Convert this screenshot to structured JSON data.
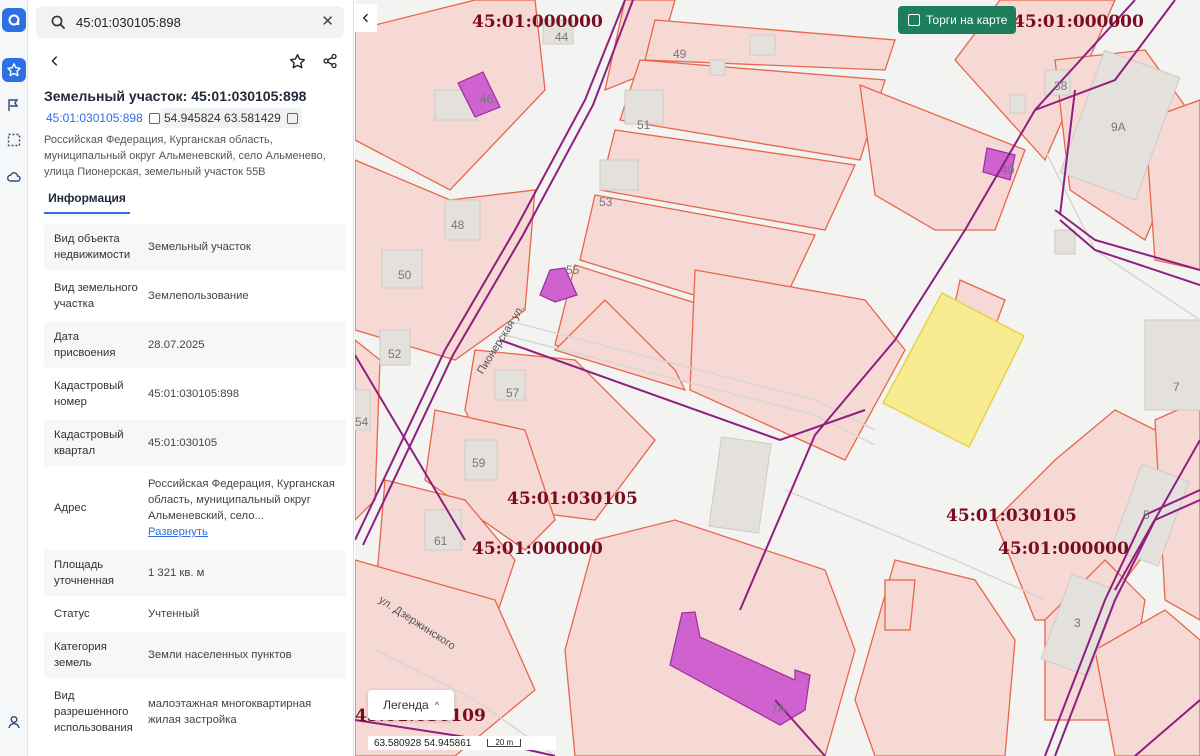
{
  "search": {
    "value": "45:01:030105:898"
  },
  "object": {
    "title": "Земельный участок: 45:01:030105:898",
    "cadastral_number": "45:01:030105:898",
    "coordinates": "54.945824 63.581429",
    "address": "Российская Федерация, Курганская область, муниципальный округ Альменевский, село Альменево, улица Пионерская, земельный участок 55В"
  },
  "tabs": [
    {
      "label": "Информация",
      "active": true
    }
  ],
  "info": [
    {
      "label": "Вид объекта недвижимости",
      "value": "Земельный участок"
    },
    {
      "label": "Вид земельного участка",
      "value": "Землепользование"
    },
    {
      "label": "Дата присвоения",
      "value": "28.07.2025"
    },
    {
      "label": "Кадастровый номер",
      "value": "45:01:030105:898"
    },
    {
      "label": "Кадастровый квартал",
      "value": "45:01:030105"
    },
    {
      "label": "Адрес",
      "value": "Российская Федерация, Курганская область, муниципальный округ Альменевский, село...",
      "link": "Развернуть"
    },
    {
      "label": "Площадь уточненная",
      "value": "1 321 кв. м"
    },
    {
      "label": "Статус",
      "value": "Учтенный"
    },
    {
      "label": "Категория земель",
      "value": "Земли населенных пунктов"
    },
    {
      "label": "Вид разрешенного использования",
      "value": "малоэтажная многоквартирная жилая застройка"
    }
  ],
  "map": {
    "torgi_label": "Торги на карте",
    "legend_label": "Легенда",
    "coords_readout": "63.580928  54.945861",
    "scale_label": "20 m",
    "cadastral_labels": [
      "45:01:000000",
      "45:01:000000",
      "45:01:030105",
      "45:01:000000",
      "45:01:030105",
      "45:01:000000",
      "45:01:030109"
    ],
    "house_numbers": [
      "44",
      "49",
      "46",
      "38",
      "51",
      "9А",
      "40",
      "53",
      "48",
      "55",
      "50",
      "52",
      "57",
      "7",
      "59",
      "54",
      "61",
      "5",
      "3",
      "7А"
    ],
    "streets": [
      "Пионерская ул.",
      "ул. Дзержинского"
    ],
    "colors": {
      "highlight": "#f7ec92",
      "parcel_fill": "#f6d9d4",
      "parcel_stroke": "#e8664a",
      "boundary": "#8e1f7f",
      "building": "#cf62cf"
    }
  }
}
